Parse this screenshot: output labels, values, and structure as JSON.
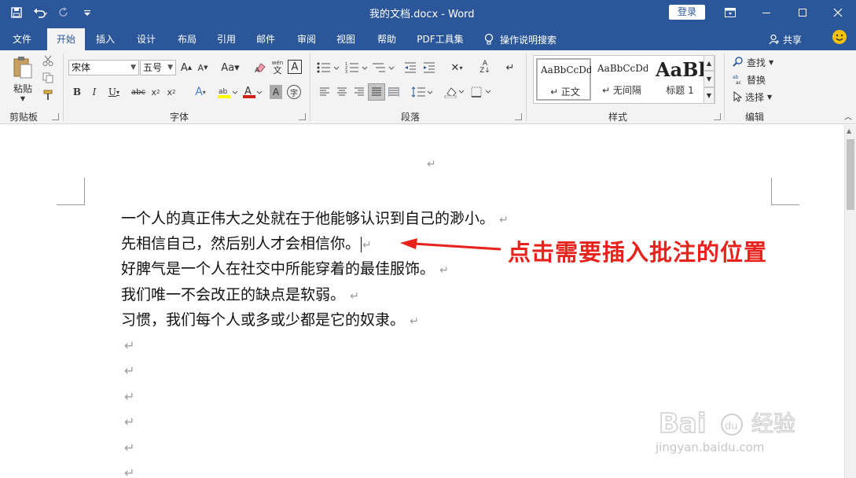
{
  "titlebar": {
    "doc_title": "我的文档.docx  -  Word",
    "login": "登录"
  },
  "tabs": [
    "文件",
    "开始",
    "插入",
    "设计",
    "布局",
    "引用",
    "邮件",
    "审阅",
    "视图",
    "帮助",
    "PDF工具集"
  ],
  "tell_me": "操作说明搜索",
  "share": "共享",
  "ribbon": {
    "clipboard": {
      "paste": "粘贴",
      "label": "剪贴板"
    },
    "font": {
      "name": "宋体",
      "size": "五号",
      "label": "字体"
    },
    "paragraph": {
      "label": "段落"
    },
    "styles": {
      "items": [
        {
          "sample": "AaBbCcDd",
          "name": "↵ 正文"
        },
        {
          "sample": "AaBbCcDd",
          "name": "↵ 无间隔"
        },
        {
          "sample": "AaBl",
          "name": "标题 1"
        }
      ],
      "label": "样式"
    },
    "editing": {
      "find": "查找",
      "replace": "替换",
      "select": "选择",
      "label": "编辑"
    }
  },
  "document": {
    "lines": [
      "一个人的真正伟大之处就在于他能够认识到自己的渺小。",
      "先相信自己，然后别人才会相信你。",
      "好脾气是一个人在社交中所能穿着的最佳服饰。",
      "我们唯一不会改正的缺点是软弱。",
      "习惯，我们每个人或多或少都是它的奴隶。"
    ],
    "para_mark": "↵"
  },
  "annotation": "点击需要插入批注的位置",
  "watermark": {
    "brand": "Bai du 经验",
    "url": "jingyan.baidu.com"
  },
  "colors": {
    "word_blue": "#2b579a",
    "ribbon_bg": "#f3f3f3",
    "annotation_red": "#e8231d"
  }
}
